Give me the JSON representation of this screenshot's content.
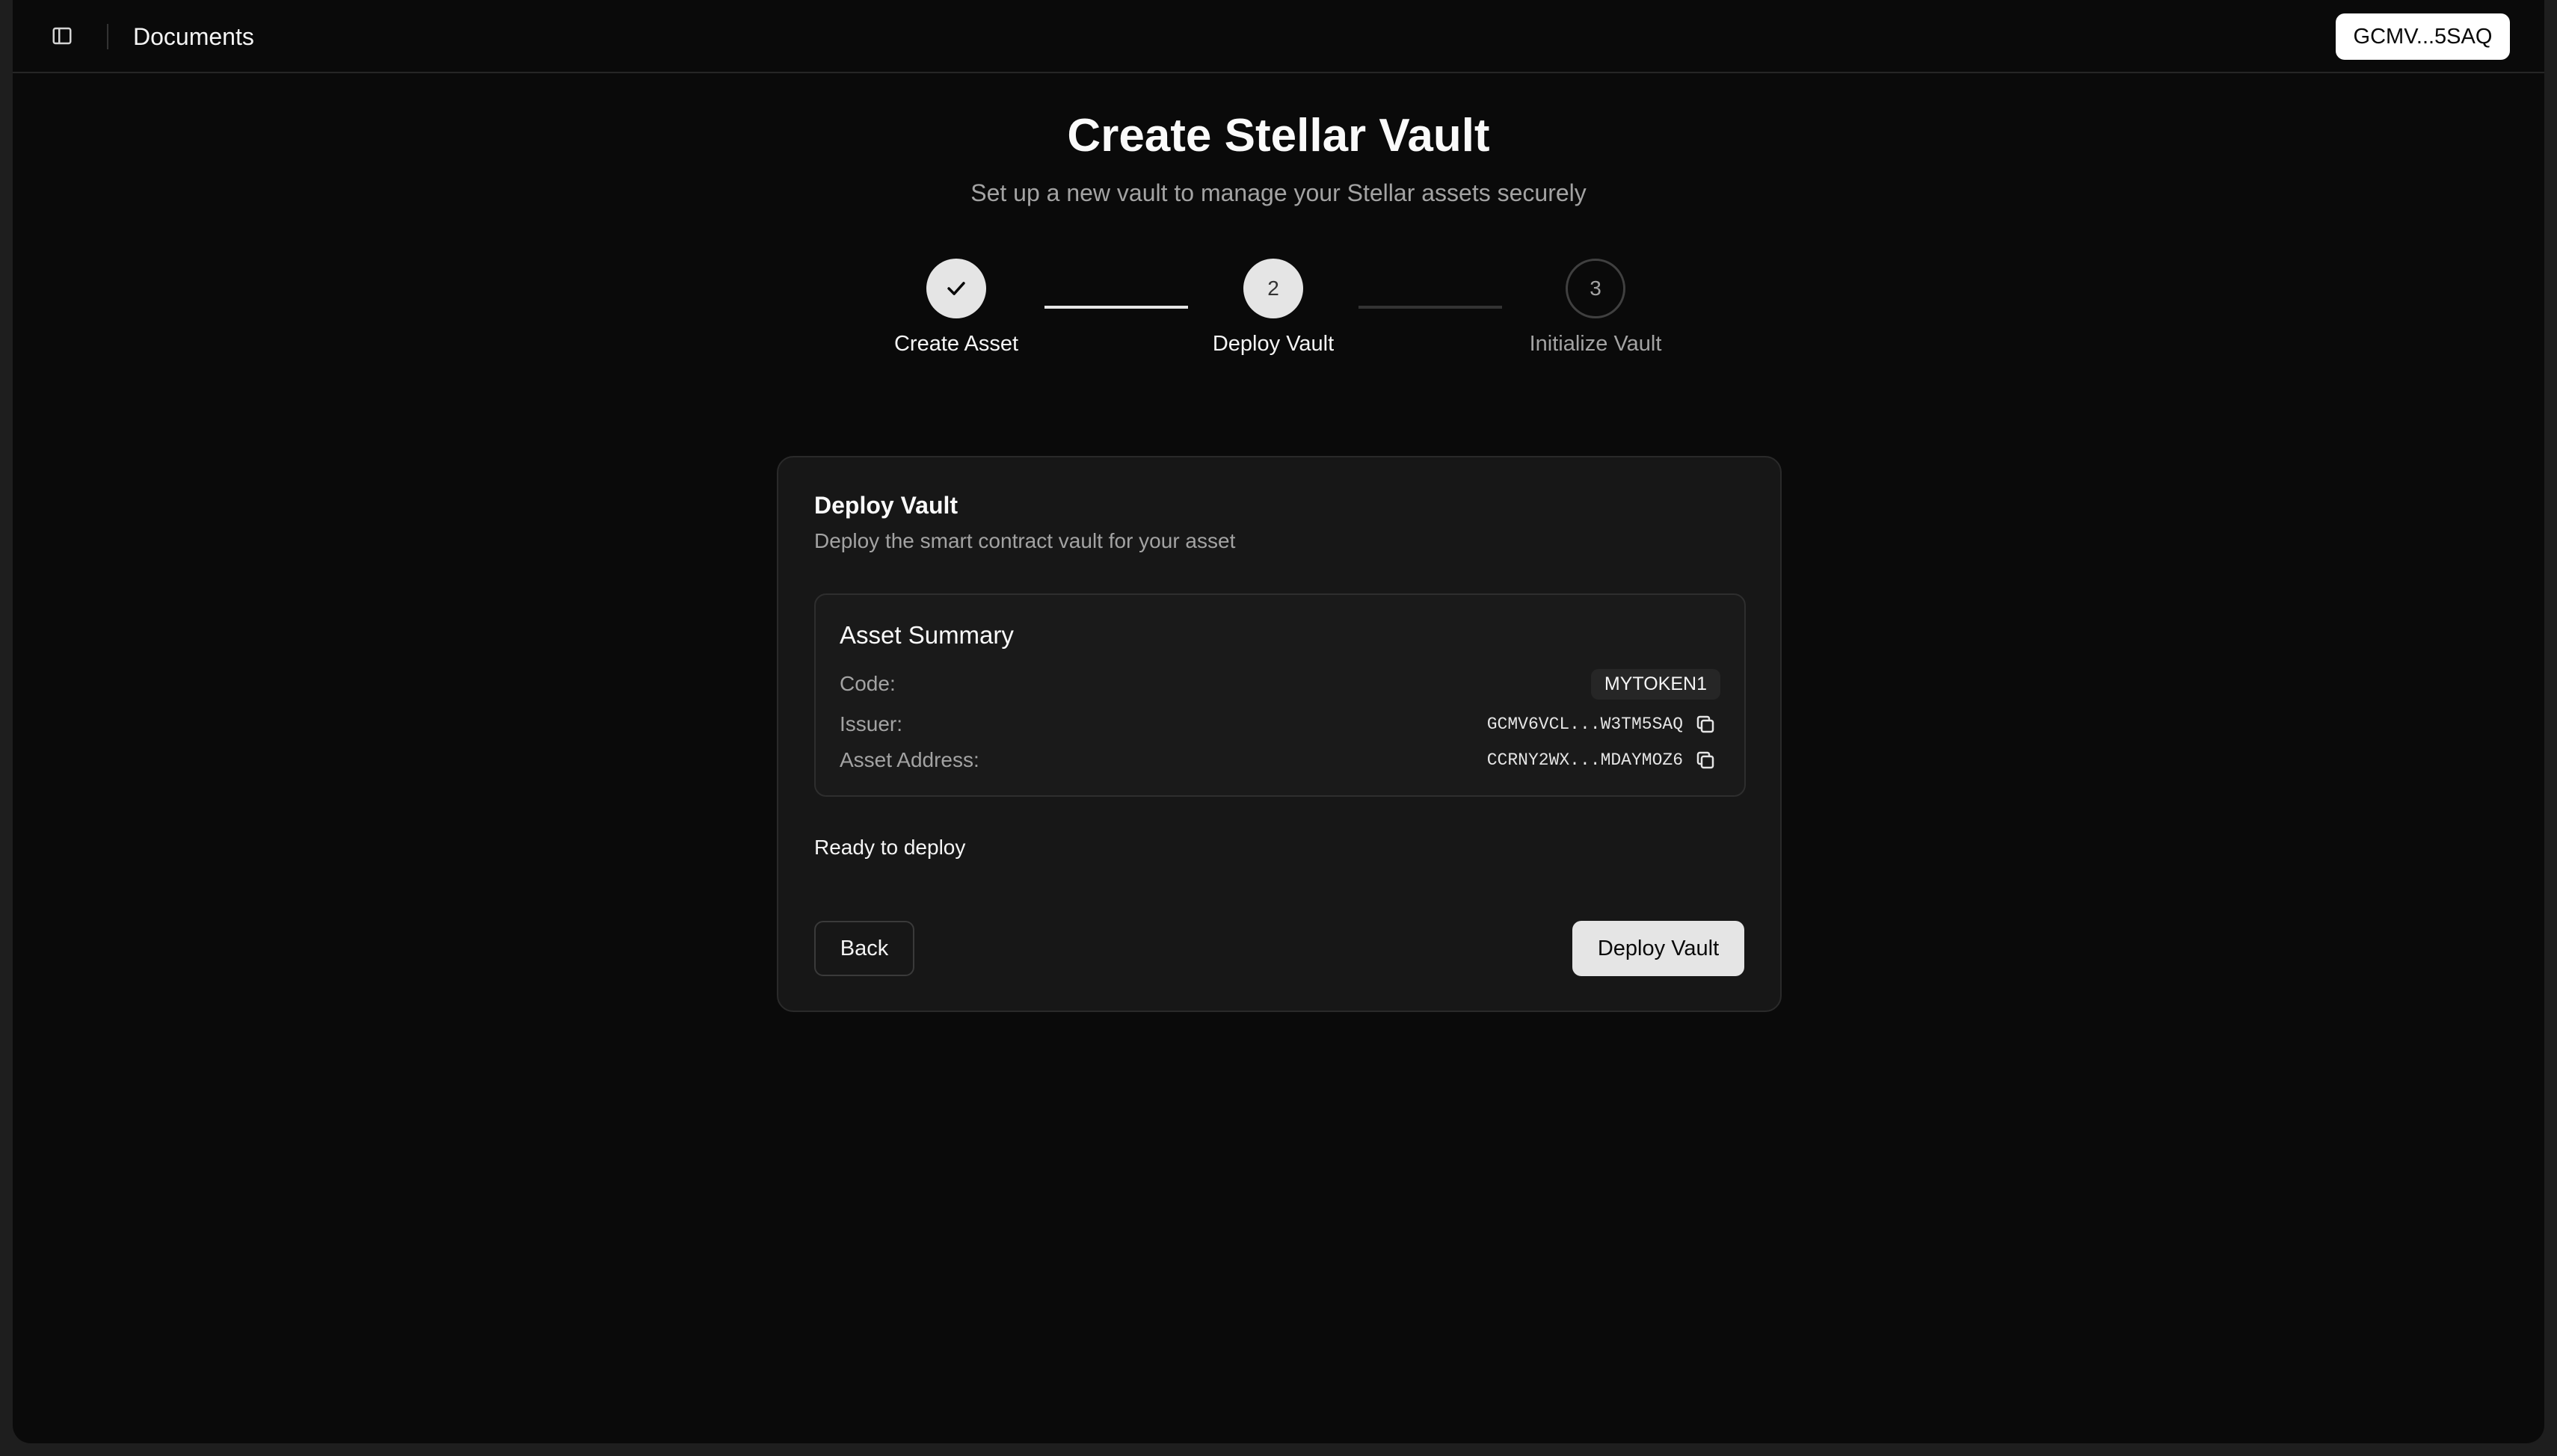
{
  "header": {
    "title": "Documents",
    "wallet_label": "GCMV...5SAQ",
    "sidebar_icon": "sidebar-toggle-icon"
  },
  "page": {
    "title": "Create Stellar Vault",
    "subtitle": "Set up a new vault to manage your Stellar assets securely"
  },
  "stepper": {
    "steps": [
      {
        "number": "1",
        "label": "Create Asset",
        "state": "completed"
      },
      {
        "number": "2",
        "label": "Deploy Vault",
        "state": "active"
      },
      {
        "number": "3",
        "label": "Initialize Vault",
        "state": "pending"
      }
    ]
  },
  "card": {
    "title": "Deploy Vault",
    "description": "Deploy the smart contract vault for your asset",
    "summary": {
      "title": "Asset Summary",
      "code_label": "Code:",
      "code_value": "MYTOKEN1",
      "issuer_label": "Issuer:",
      "issuer_value": "GCMV6VCL...W3TM5SAQ",
      "address_label": "Asset Address:",
      "address_value": "CCRNY2WX...MDAYMOZ6"
    },
    "status": "Ready to deploy",
    "back_label": "Back",
    "deploy_label": "Deploy Vault"
  },
  "colors": {
    "background": "#0a0a0a",
    "card": "#171717",
    "primary_button": "#e5e5e5",
    "muted_text": "#a3a3a3"
  }
}
